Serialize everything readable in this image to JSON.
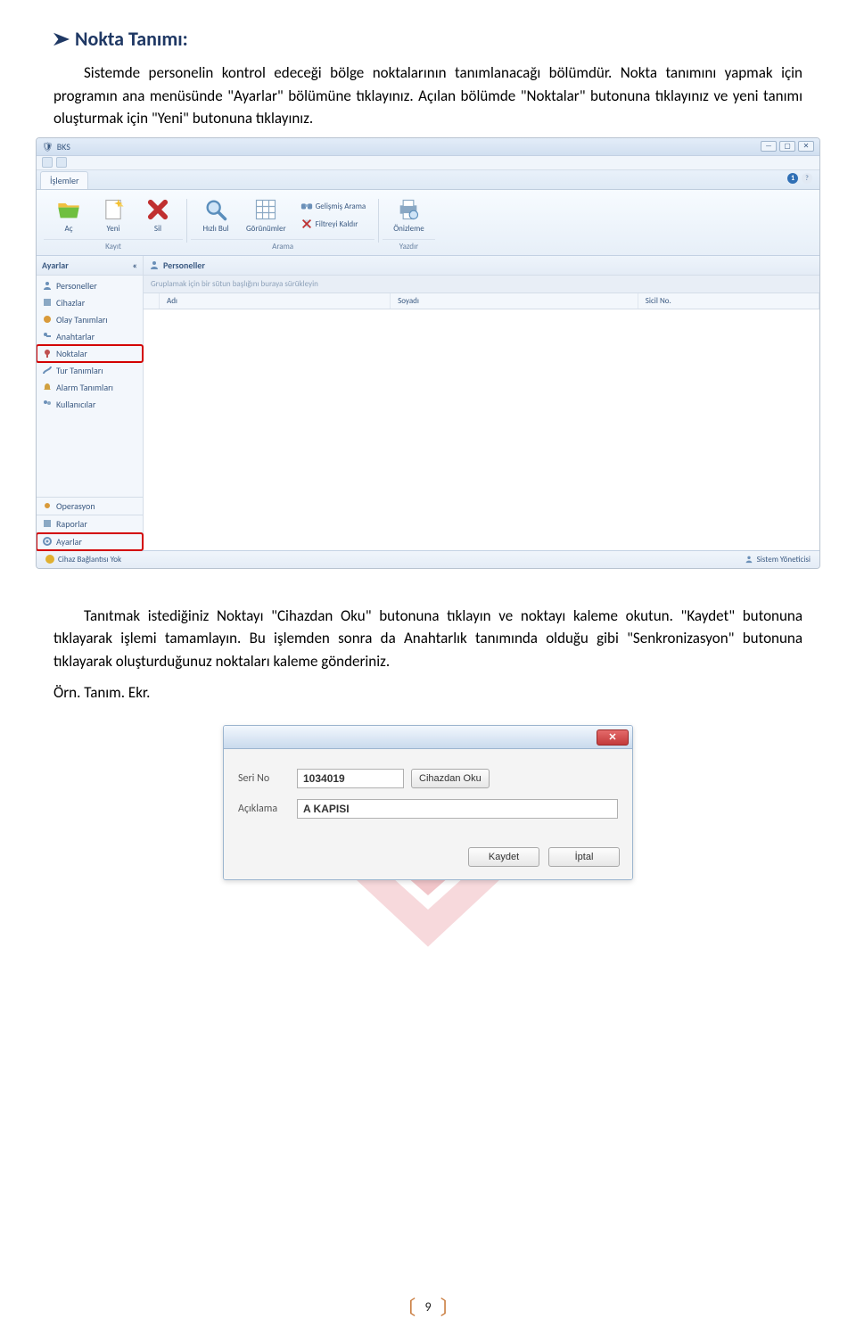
{
  "heading": "Nokta Tanımı:",
  "para1": "Sistemde personelin kontrol edeceği bölge noktalarının tanımlanacağı bölümdür. Nokta tanımını yapmak için programın ana menüsünde \"Ayarlar\" bölümüne tıklayınız. Açılan bölümde \"Noktalar\" butonuna tıklayınız ve yeni tanımı oluşturmak için \"Yeni\" butonuna tıklayınız.",
  "para2": "Tanıtmak istediğiniz Noktayı \"Cihazdan Oku\" butonuna tıklayın ve noktayı kaleme okutun. \"Kaydet\" butonuna tıklayarak işlemi tamamlayın. Bu işlemden sonra da Anahtarlık tanımında olduğu gibi \"Senkronizasyon\" butonuna tıklayarak oluşturduğunuz noktaları kaleme gönderiniz.",
  "exampleCaption": "Örn. Tanım. Ekr.",
  "pageNumber": "9",
  "bks": {
    "title": "BKS",
    "tab": "İşlemler",
    "ribbon": {
      "ac": "Aç",
      "yeni": "Yeni",
      "sil": "Sil",
      "hizli": "Hızlı Bul",
      "gorunum": "Görünümler",
      "gelismis": "Gelişmiş Arama",
      "filtre": "Filtreyi Kaldır",
      "onizleme": "Önizleme",
      "grpKayit": "Kayıt",
      "grpArama": "Arama",
      "grpYazdir": "Yazdır"
    },
    "sidebar": {
      "head": "Ayarlar",
      "items": [
        "Personeller",
        "Cihazlar",
        "Olay Tanımları",
        "Anahtarlar",
        "Noktalar",
        "Tur Tanımları",
        "Alarm Tanımları",
        "Kullanıcılar"
      ],
      "groups": [
        "Operasyon",
        "Raporlar",
        "Ayarlar"
      ]
    },
    "main": {
      "title": "Personeller",
      "groupHint": "Gruplamak için bir sütun başlığını buraya sürükleyin",
      "cols": [
        "Adı",
        "Soyadı",
        "Sicil No."
      ]
    },
    "status": {
      "left": "Cihaz Bağlantısı Yok",
      "right": "Sistem Yöneticisi"
    }
  },
  "dialog": {
    "seriNoLabel": "Seri No",
    "seriNoValue": "1034019",
    "cihazdanOku": "Cihazdan Oku",
    "aciklamaLabel": "Açıklama",
    "aciklamaValue": "A KAPISI",
    "kaydet": "Kaydet",
    "iptal": "İptal"
  }
}
